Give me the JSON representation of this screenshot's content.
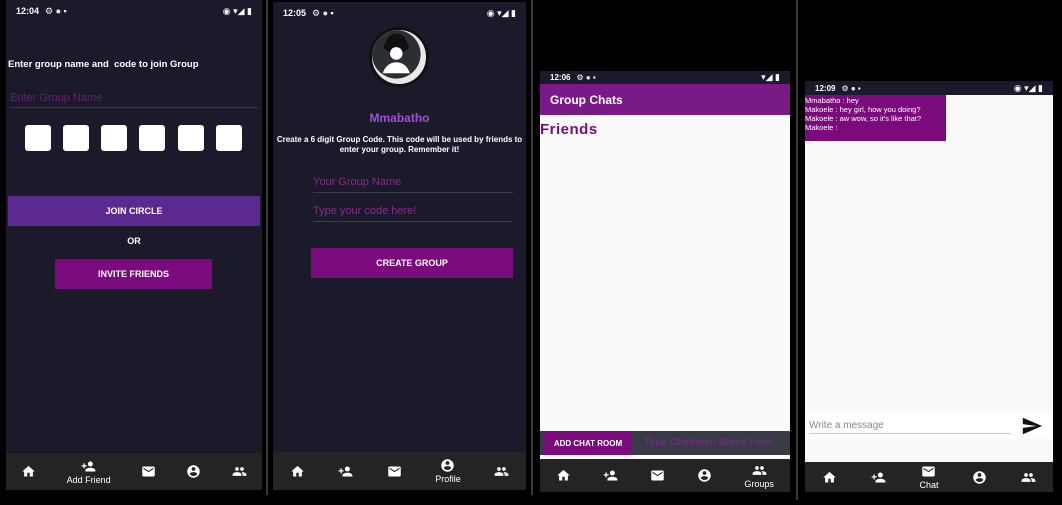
{
  "screen1": {
    "time": "12:04",
    "prompt": "Enter group name and  code to join Group",
    "group_name_placeholder": "Enter Group Name",
    "join_label": "JOIN CIRCLE",
    "or_label": "OR",
    "invite_label": "INVITE FRIENDS",
    "nav_active_label": "Add Friend"
  },
  "screen2": {
    "time": "12:05",
    "username": "Mmabatho",
    "instructions": "Create a 6 digit Group Code. This code will be used by friends to enter your group. Remember it!",
    "group_name_placeholder": "Your Group Name",
    "code_placeholder": "Type your code here!",
    "create_label": "CREATE GROUP",
    "nav_active_label": "Profile"
  },
  "screen3": {
    "time": "12:06",
    "title": "Group Chats",
    "friends_heading": "Friends",
    "add_room_label": "ADD CHAT ROOM",
    "room_name_placeholder": "Type Chatroom Name Here",
    "nav_active_label": "Groups"
  },
  "screen4": {
    "time": "12:09",
    "messages": [
      "Mmabatho  : hey",
      "Makoele : hey girl, how you doing?",
      "Makoele : aw wow, so it's like that?",
      "Makoele :"
    ],
    "message_placeholder": "Write a message",
    "nav_active_label": "Chat"
  },
  "colors": {
    "dark_bg": "#1a1a2b",
    "purple": "#7b0a7d",
    "violet": "#5c2a8e",
    "nav_bg": "#242424"
  },
  "icons": [
    "home-icon",
    "add-friend-icon",
    "mail-icon",
    "profile-icon",
    "groups-icon",
    "send-icon"
  ]
}
